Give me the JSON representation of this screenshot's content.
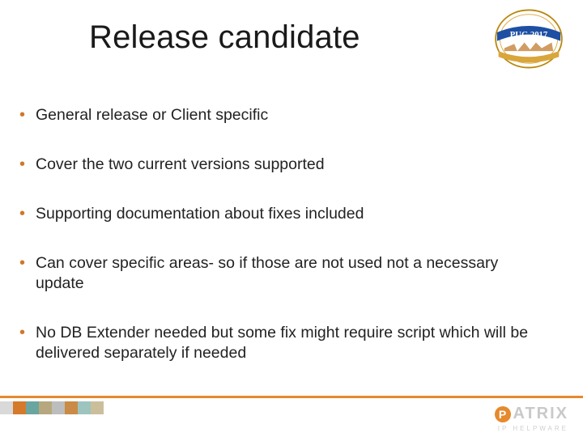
{
  "title": "Release candidate",
  "badge": {
    "topText": "PUG 2017",
    "topColor": "#1e4fa3",
    "ribbonColor": "#d9a63b",
    "outlineColor": "#b8860b"
  },
  "bullets": [
    "General release or Client specific",
    "Cover the two current versions supported",
    "Supporting documentation about fixes included",
    "Can cover specific areas- so if those are not used not a necessary update",
    "No DB Extender needed but some fix might require script which will be delivered separately if needed"
  ],
  "footer": {
    "lineColor": "#e68a2e",
    "swatches": [
      "#d9d9d9",
      "#d47a2a",
      "#6aa5a0",
      "#b7a77e",
      "#bdbdbd",
      "#c98b46",
      "#9dc4bf",
      "#cbbf9b"
    ]
  },
  "logo": {
    "brand": "ATRIX",
    "tagline": "IP HELPWARE",
    "accent": "#e68a2e"
  }
}
